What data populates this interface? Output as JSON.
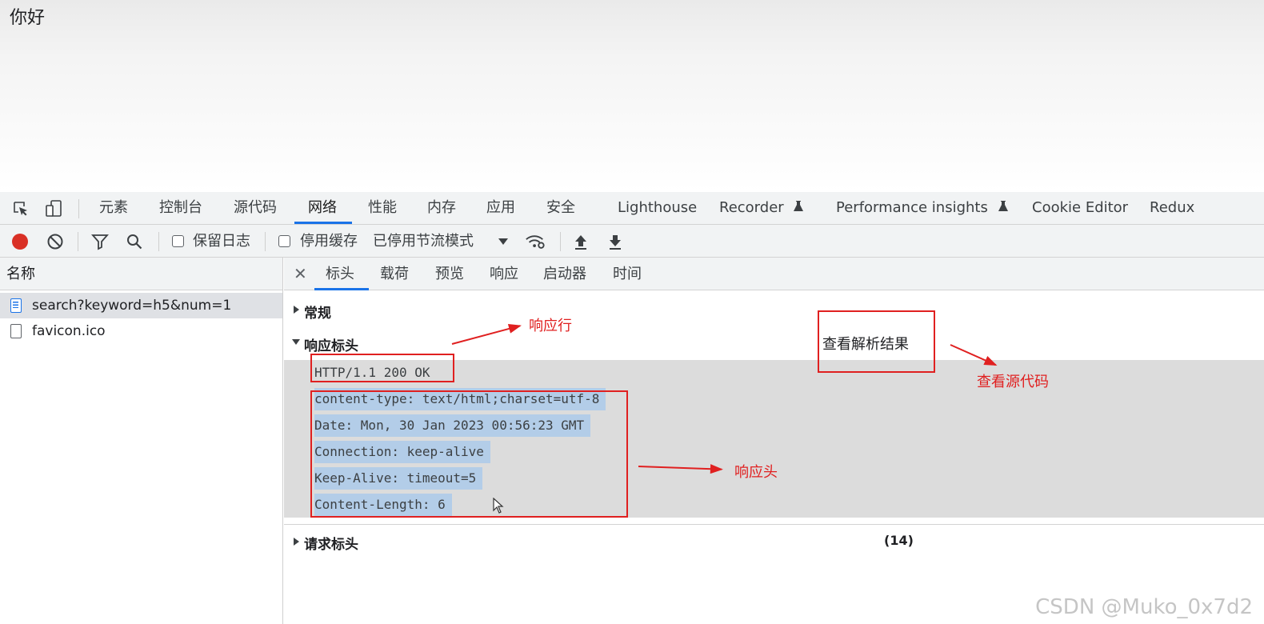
{
  "page": {
    "text": "你好"
  },
  "devtools": {
    "tabs": [
      "元素",
      "控制台",
      "源代码",
      "网络",
      "性能",
      "内存",
      "应用",
      "安全",
      "Lighthouse",
      "Recorder",
      "Performance insights",
      "Cookie Editor",
      "Redux"
    ],
    "active_tab": "网络",
    "toolbar": {
      "preserve_log_label": "保留日志",
      "disable_cache_label": "停用缓存",
      "throttling_value": "已停用节流模式"
    },
    "name_panel": {
      "header": "名称",
      "requests": [
        {
          "name": "search?keyword=h5&num=1",
          "selected": true,
          "type": "document"
        },
        {
          "name": "favicon.ico",
          "selected": false,
          "type": "other"
        }
      ]
    },
    "detail": {
      "tabs": [
        "标头",
        "载荷",
        "预览",
        "响应",
        "启动器",
        "时间"
      ],
      "active_tab": "标头",
      "general_title": "常规",
      "response_headers_title": "响应标头",
      "raw_lines": [
        "HTTP/1.1 200 OK",
        "content-type: text/html;charset=utf-8",
        "Date: Mon, 30 Jan 2023 00:56:23 GMT",
        "Connection: keep-alive",
        "Keep-Alive: timeout=5",
        "Content-Length: 6"
      ],
      "view_parsed_label": "查看解析结果",
      "request_headers_title": "请求标头",
      "request_headers_count": "(14)"
    }
  },
  "annotations": {
    "response_line": "响应行",
    "view_source": "查看源代码",
    "response_headers": "响应头",
    "color": "#e02020"
  },
  "watermark": "CSDN @Muko_0x7d2"
}
